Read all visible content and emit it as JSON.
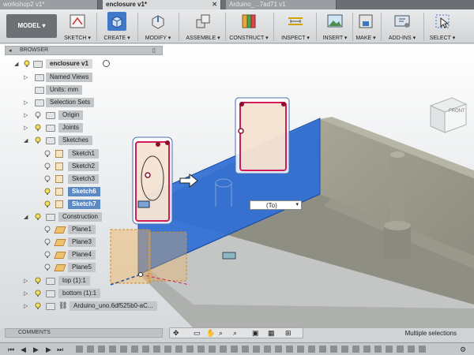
{
  "tabs": [
    {
      "label": "workshop2 v1*"
    },
    {
      "label": "enclosure v1*"
    },
    {
      "label": "Arduino_...7ad71 v1"
    }
  ],
  "toolbar": {
    "model_label": "MODEL",
    "groups": [
      {
        "label": "SKETCH",
        "icon": "sketch-icon"
      },
      {
        "label": "CREATE",
        "icon": "create-box-icon"
      },
      {
        "label": "MODIFY",
        "icon": "modify-icon"
      },
      {
        "label": "ASSEMBLE",
        "icon": "assemble-icon"
      },
      {
        "label": "CONSTRUCT",
        "icon": "construct-plane-icon"
      },
      {
        "label": "INSPECT",
        "icon": "inspect-icon"
      },
      {
        "label": "INSERT",
        "icon": "insert-image-icon"
      },
      {
        "label": "MAKE",
        "icon": "make-printer-icon"
      },
      {
        "label": "ADD-INS",
        "icon": "add-ins-icon"
      },
      {
        "label": "SELECT",
        "icon": "select-cursor-icon"
      }
    ]
  },
  "browser": {
    "header": "BROWSER",
    "root": "enclosure v1",
    "items": [
      {
        "label": "Named Views"
      },
      {
        "label": "Units: mm"
      },
      {
        "label": "Selection Sets"
      },
      {
        "label": "Origin"
      },
      {
        "label": "Joints"
      },
      {
        "label": "Sketches"
      },
      {
        "label": "Sketch1"
      },
      {
        "label": "Sketch2"
      },
      {
        "label": "Sketch3"
      },
      {
        "label": "Sketch6"
      },
      {
        "label": "Sketch7"
      },
      {
        "label": "Construction"
      },
      {
        "label": "Plane1"
      },
      {
        "label": "Plane3"
      },
      {
        "label": "Plane4"
      },
      {
        "label": "Plane5"
      },
      {
        "label": "top (1):1"
      },
      {
        "label": "bottom (1):1"
      },
      {
        "label": "Arduino_uno.6df525b0-aC..."
      }
    ]
  },
  "viewport": {
    "dropdown_value": "(To)",
    "viewcube_label": "FRONT"
  },
  "comments_label": "COMMENTS",
  "status_text": "Multiple selections",
  "colors": {
    "accent": "#2f6fd6",
    "selection": "#5b8ac4",
    "sketch_profile": "#f3dcc8",
    "plane": "#f0b25a"
  }
}
